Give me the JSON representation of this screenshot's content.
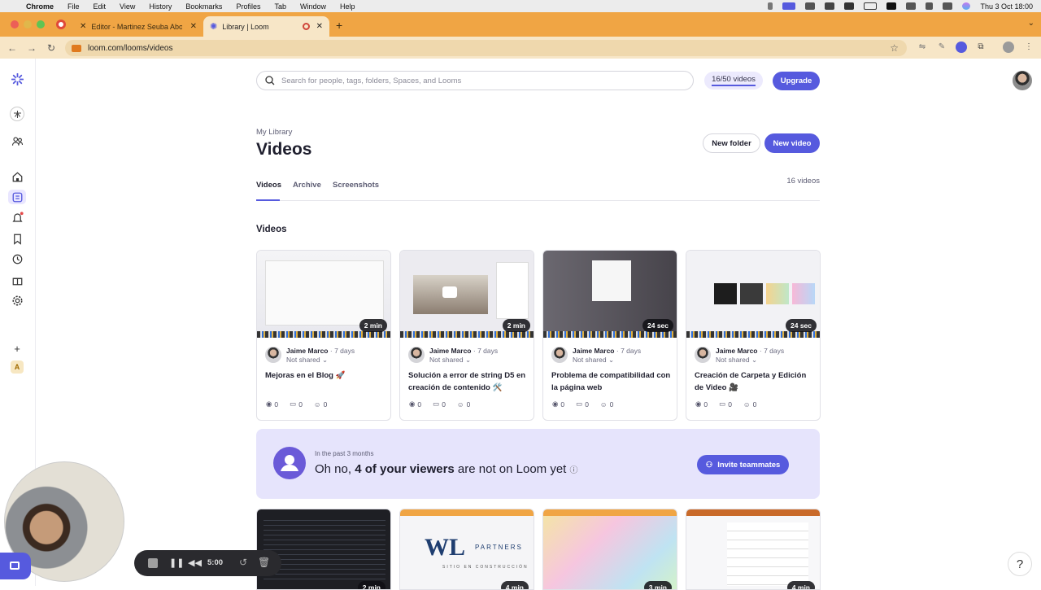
{
  "os_menubar": {
    "items": [
      "Chrome",
      "File",
      "Edit",
      "View",
      "History",
      "Bookmarks",
      "Profiles",
      "Tab",
      "Window",
      "Help"
    ],
    "clock": "Thu 3 Oct  18:00"
  },
  "browser": {
    "tabs": [
      {
        "title": "Editor - Martinez Seuba Abog"
      },
      {
        "title": "Library | Loom"
      }
    ],
    "url": "loom.com/looms/videos"
  },
  "header": {
    "search_placeholder": "Search for people, tags, folders, Spaces, and Looms",
    "video_quota": "16/50 videos",
    "upgrade_label": "Upgrade"
  },
  "page": {
    "breadcrumb": "My Library",
    "title": "Videos",
    "new_folder_label": "New folder",
    "new_video_label": "New video",
    "tabs": [
      "Videos",
      "Archive",
      "Screenshots"
    ],
    "video_count": "16 videos",
    "section_title": "Videos"
  },
  "videos": [
    {
      "duration": "2 min",
      "owner": "Jaime Marco",
      "age": "· 7 days",
      "sharing": "Not shared",
      "title": "Mejoras en el Blog 🚀",
      "views": "0",
      "comments": "0",
      "reactions": "0"
    },
    {
      "duration": "2 min",
      "owner": "Jaime Marco",
      "age": "· 7 days",
      "sharing": "Not shared",
      "title": "Solución a error de string D5 en creación de contenido 🛠️",
      "views": "0",
      "comments": "0",
      "reactions": "0"
    },
    {
      "duration": "24 sec",
      "owner": "Jaime Marco",
      "age": "· 7 days",
      "sharing": "Not shared",
      "title": "Problema de compatibilidad con la página web",
      "views": "0",
      "comments": "0",
      "reactions": "0"
    },
    {
      "duration": "24 sec",
      "owner": "Jaime Marco",
      "age": "· 7 days",
      "sharing": "Not shared",
      "title": "Creación de Carpeta y Edición de Video 🎥",
      "views": "0",
      "comments": "0",
      "reactions": "0"
    }
  ],
  "banner": {
    "subtitle": "In the past 3 months",
    "message_prefix": "Oh no, ",
    "message_bold": "4 of your viewers",
    "message_suffix": " are not on Loom yet",
    "invite_label": "Invite teammates"
  },
  "second_row": [
    {
      "duration": "2 min"
    },
    {
      "duration": "4 min",
      "logo_text": "PARTNERS",
      "logo_sub": "SITIO EN CONSTRUCCIÓN"
    },
    {
      "duration": "3 min"
    },
    {
      "duration": "4 min"
    }
  ],
  "recorder": {
    "timer": "5:00"
  },
  "help_label": "?"
}
